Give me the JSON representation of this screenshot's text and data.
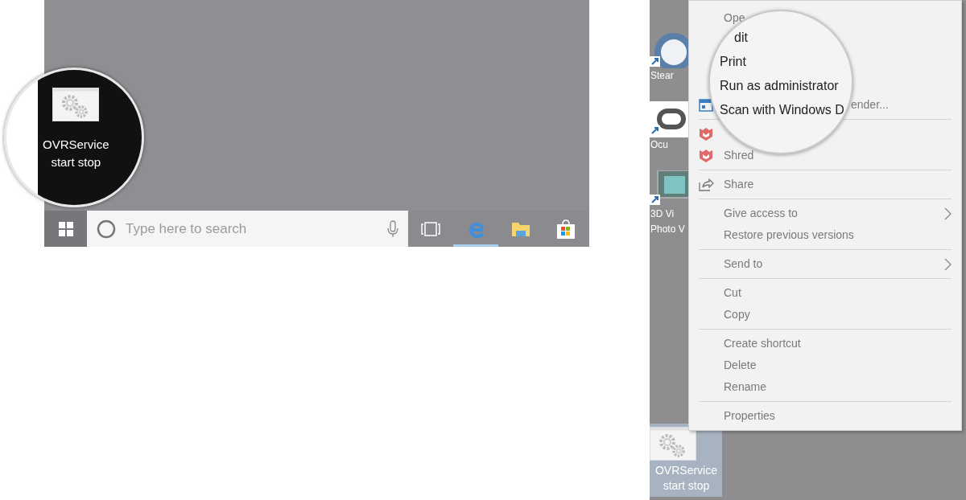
{
  "left_screen": {
    "desktop_icon": {
      "label": "OVRService\nstart stop"
    },
    "taskbar": {
      "search": {
        "placeholder": "Type here to search"
      },
      "apps": [
        {
          "kind": "task-view",
          "active": false
        },
        {
          "kind": "browser",
          "active": true
        },
        {
          "kind": "folder",
          "active": false
        },
        {
          "kind": "store",
          "active": false
        }
      ]
    }
  },
  "right_screen": {
    "desktop_icons": [
      {
        "kind": "steam",
        "label": "Stear",
        "selected": false
      },
      {
        "kind": "oculus",
        "label": "Ocu",
        "selected": false
      },
      {
        "kind": "photo",
        "label": "3D Vi\nPhoto V",
        "selected": false
      },
      {
        "kind": "service",
        "label": "OVRService\nstart stop",
        "selected": true
      }
    ],
    "context_menu": {
      "groups": [
        [
          {
            "kind": "plain",
            "label": "Ope"
          },
          {
            "kind": "plain"
          },
          {
            "kind": "plain"
          },
          {
            "kind": "plain"
          },
          {
            "kind": "scan",
            "label": "ender..."
          }
        ],
        [
          {
            "kind": "shred"
          },
          {
            "kind": "shred",
            "label": "Shred"
          }
        ],
        [
          {
            "kind": "share",
            "label": "Share"
          }
        ],
        [
          {
            "kind": "plain",
            "label": "Give access to",
            "submenu": true
          },
          {
            "kind": "plain",
            "label": "Restore previous versions"
          }
        ],
        [
          {
            "kind": "plain",
            "label": "Send to",
            "submenu": true
          }
        ],
        [
          {
            "kind": "plain",
            "label": "Cut"
          },
          {
            "kind": "plain",
            "label": "Copy"
          }
        ],
        [
          {
            "kind": "plain",
            "label": "Create shortcut"
          },
          {
            "kind": "plain",
            "label": "Delete"
          },
          {
            "kind": "plain",
            "label": "Rename"
          }
        ],
        [
          {
            "kind": "plain",
            "label": "Properties"
          }
        ]
      ]
    },
    "magnifier": {
      "items": [
        "dit",
        "Print",
        "Run as administrator",
        "Scan with Windows D"
      ]
    }
  }
}
